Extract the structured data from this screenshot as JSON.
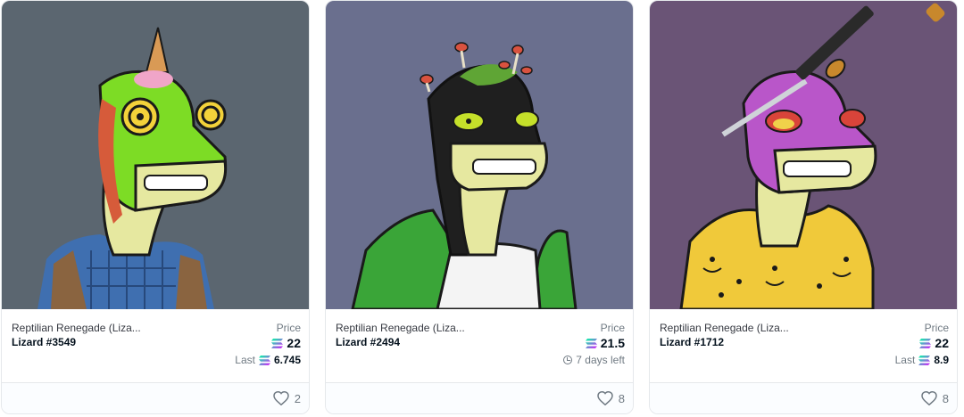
{
  "colors": {
    "bg_card1": "#5b6670",
    "bg_card2": "#6a6f8e",
    "bg_card3": "#6a5476",
    "solana_gradient": [
      "#00ffa3",
      "#03e1ff",
      "#dc1fff"
    ]
  },
  "cards": [
    {
      "collection": "Reptilian Renegade (Liza...",
      "token": "Lizard #3549",
      "price_label": "Price",
      "price": "22",
      "sub_label": "Last",
      "sub_value": "6.745",
      "likes": "2",
      "art_description": "lizard with ice cream cone horn, spiral eyes, blue plaid shirt and vest"
    },
    {
      "collection": "Reptilian Renegade (Liza...",
      "token": "Lizard #2494",
      "price_label": "Price",
      "price": "21.5",
      "sub_label": "7 days left",
      "likes": "8",
      "art_description": "black-hooded lizard with mushrooms, green jacket"
    },
    {
      "collection": "Reptilian Renegade (Liza...",
      "token": "Lizard #1712",
      "price_label": "Price",
      "price": "22",
      "sub_label": "Last",
      "sub_value": "8.9",
      "likes": "8",
      "art_description": "purple lizard with katana through head, yellow smiley hoodie"
    }
  ]
}
